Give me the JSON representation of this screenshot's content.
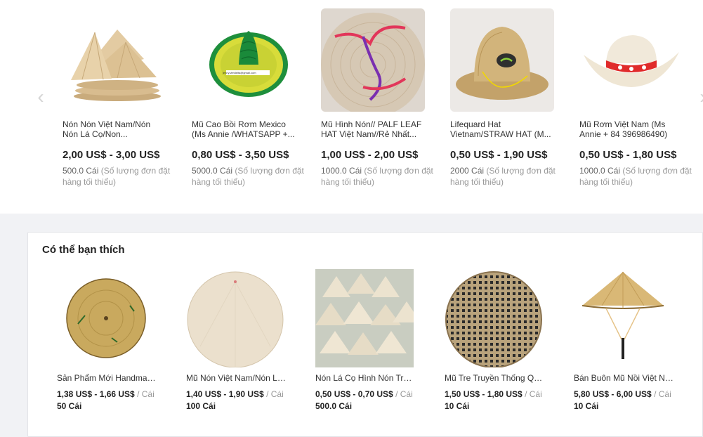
{
  "carousel": {
    "prev_icon": "chevron-left-icon",
    "next_icon": "chevron-right-icon",
    "products": [
      {
        "image": "stacked-conical-hats",
        "title": "Nón Nón Việt Nam/Nón Nón Lá Cọ/Non...",
        "price": "2,00 US$ - 3,00 US$",
        "moq_qty": "500.0 Cái",
        "moq_label": "(Số lượng đơn đặt hàng tối thiểu)"
      },
      {
        "image": "sombrero-hat",
        "title": "Mũ Cao Bồi Rơm Mexico (Ms Annie /WHATSAPP +...",
        "price": "0,80 US$ - 3,50 US$",
        "moq_qty": "5000.0 Cái",
        "moq_label": "(Số lượng đơn đặt hàng tối thiểu)",
        "image_caption": "jenny.vietdelta@gmail.com"
      },
      {
        "image": "palm-leaf-hat-underside",
        "title": "Mũ Hình Nón// PALF LEAF HAT Việt Nam//Rẻ Nhất...",
        "price": "1,00 US$ - 2,00 US$",
        "moq_qty": "1000.0 Cái",
        "moq_label": "(Số lượng đơn đặt hàng tối thiểu)"
      },
      {
        "image": "lifeguard-straw-hat",
        "title": "Lifequard Hat Vietnam/STRAW HAT (M...",
        "price": "0,50 US$ - 1,90 US$",
        "moq_qty": "2000 Cái",
        "moq_label": "(Số lượng đơn đặt hàng tối thiểu)"
      },
      {
        "image": "straw-cowboy-hat",
        "title": "Mũ Rơm Việt Nam (Ms Annie + 84 396986490)",
        "price": "0,50 US$ - 1,80 US$",
        "moq_qty": "1000.0 Cái",
        "moq_label": "(Số lượng đơn đặt hàng tối thiểu)"
      }
    ]
  },
  "recommend": {
    "title": "Có thể bạn thích",
    "products": [
      {
        "image": "painted-conical-hat",
        "title": "Sản Phẩm Mới Handmade Nón Lá",
        "price": "1,38 US$ - 1,66 US$",
        "unit": "/ Cái",
        "qty": "50 Cái"
      },
      {
        "image": "white-conical-hat",
        "title": "Mũ Nón Việt Nam/Nón Lá Trắng",
        "price": "1,40 US$ - 1,90 US$",
        "unit": "/ Cái",
        "qty": "100 Cái"
      },
      {
        "image": "conical-hat-pile",
        "title": "Nón Lá Cọ Hình Nón Truyền Thống",
        "price": "0,50 US$ - 0,70 US$",
        "unit": "/ Cái",
        "qty": "500.0 Cái"
      },
      {
        "image": "woven-bamboo-hat",
        "title": "Mũ Tre Truyền Thống Quạt",
        "price": "1,50 US$ - 1,80 US$",
        "unit": "/ Cái",
        "qty": "10 Cái"
      },
      {
        "image": "asian-conical-hat-strap",
        "title": "Bán Buôn Mũ Nồi Việt Nam",
        "price": "5,80 US$ - 6,00 US$",
        "unit": "/ Cái",
        "qty": "10 Cái"
      }
    ]
  }
}
